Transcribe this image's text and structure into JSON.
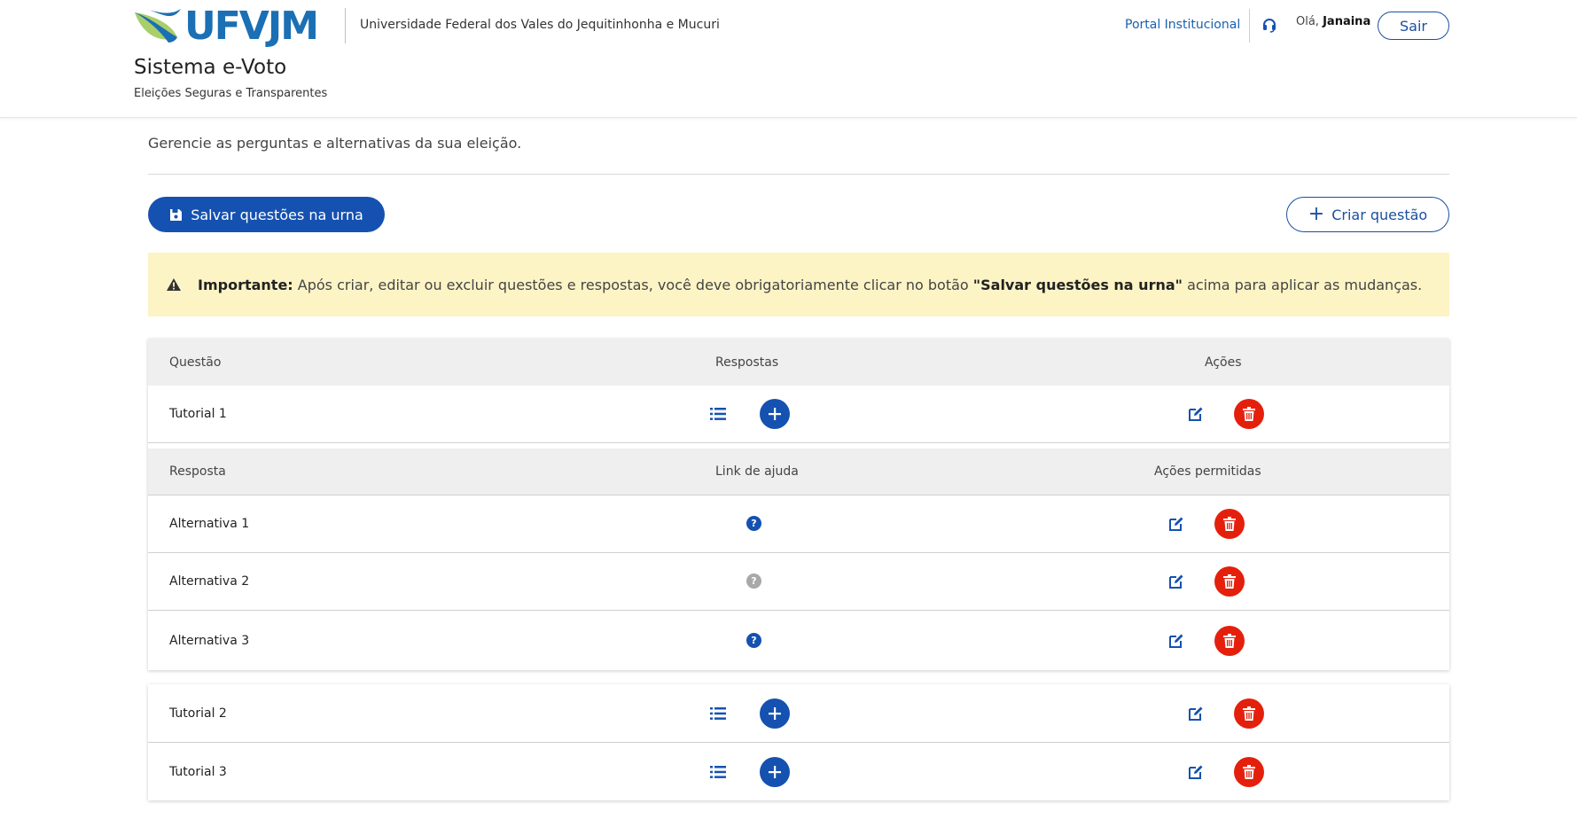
{
  "header": {
    "logo_text": "UFVJM",
    "university_name": "Universidade Federal dos Vales do Jequitinhonha e Mucuri",
    "system_title": "Sistema e-Voto",
    "system_subtitle": "Eleições Seguras e Transparentes",
    "portal_link": "Portal Institucional",
    "greeting_prefix": "Olá,",
    "user_name": "Janaina",
    "logout_label": "Sair"
  },
  "main": {
    "intro_text": "Gerencie as perguntas e alternativas da sua eleição.",
    "save_button_label": "Salvar questões na urna",
    "create_button_label": "Criar questão",
    "alert": {
      "strong_label": "Importante:",
      "text_before": " Após criar, editar ou excluir questões e respostas, você deve obrigatoriamente clicar no botão ",
      "button_ref": "\"Salvar questões na urna\"",
      "text_after": " acima para aplicar as mudanças."
    }
  },
  "questions_table": {
    "headers": {
      "question": "Questão",
      "answers": "Respostas",
      "actions": "Ações"
    },
    "questions": [
      {
        "label": "Tutorial 1",
        "expanded": true
      },
      {
        "label": "Tutorial 2",
        "expanded": false
      },
      {
        "label": "Tutorial 3",
        "expanded": false
      }
    ]
  },
  "answers_table": {
    "headers": {
      "answer": "Resposta",
      "help_link": "Link de ajuda",
      "permitted_actions": "Ações permitidas"
    },
    "answers": [
      {
        "label": "Alternativa 1",
        "help_link_active": true
      },
      {
        "label": "Alternativa 2",
        "help_link_active": false
      },
      {
        "label": "Alternativa 3",
        "help_link_active": true
      }
    ]
  },
  "colors": {
    "primary": "#1551b0",
    "danger": "#e4200c",
    "alert_bg": "#fdf4c6",
    "help_active": "#1551b0",
    "help_inactive": "#a8a8a8"
  }
}
